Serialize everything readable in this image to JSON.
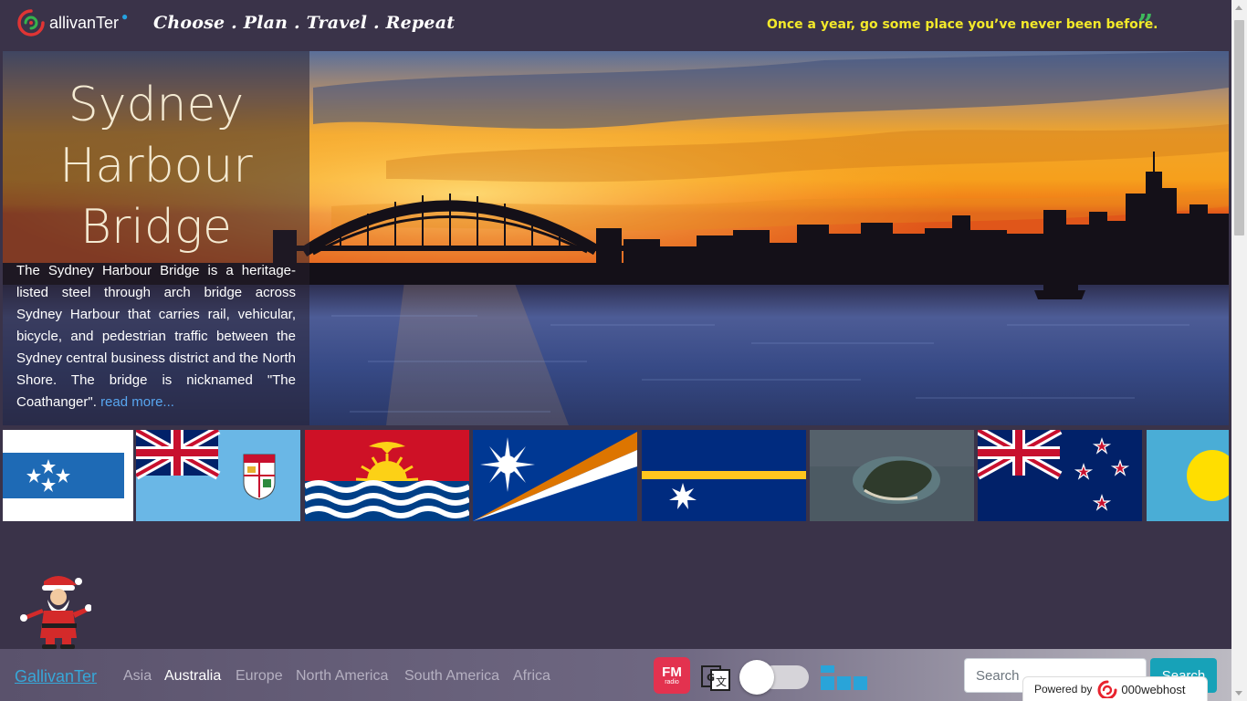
{
  "header": {
    "logo_text": "allivanTer",
    "tagline": "Choose . Plan . Travel . Repeat",
    "quote": "Once a year, go some place you’ve never been before.",
    "quote_icon": "quote-close-icon"
  },
  "hero": {
    "title": "Sydney Harbour Bridge",
    "description": "The Sydney Harbour Bridge is a heritage-listed steel through arch bridge across Sydney Harbour that carries rail, vehicular, bicycle, and pedestrian traffic between the Sydney central business district and the North Shore. The bridge is nicknamed \"The Coathanger\".",
    "read_more": "read more..."
  },
  "flags": [
    {
      "name": "flag-micronesia"
    },
    {
      "name": "flag-fiji"
    },
    {
      "name": "flag-kiribati"
    },
    {
      "name": "flag-marshall-islands"
    },
    {
      "name": "flag-nauru"
    },
    {
      "name": "island-aerial-photo"
    },
    {
      "name": "flag-new-zealand"
    },
    {
      "name": "flag-palau"
    }
  ],
  "navbar": {
    "brand": "GallivanTer",
    "links": [
      "Asia",
      "Australia",
      "Europe",
      "North America",
      "South America",
      "Africa"
    ],
    "active_link": "Australia",
    "fm_radio_top": "FM",
    "fm_radio_bottom": "radio",
    "search_placeholder": "Search",
    "search_button": "Search"
  },
  "powered_by": {
    "label": "Powered by",
    "brand": "000webhost"
  },
  "colors": {
    "background": "#3a3349",
    "tagline_quote": "#f3e92a",
    "quote_icon": "#3eb95c",
    "brand": "#37a7d8",
    "search_button": "#17a2b8",
    "fm_radio": "#e3324f"
  }
}
